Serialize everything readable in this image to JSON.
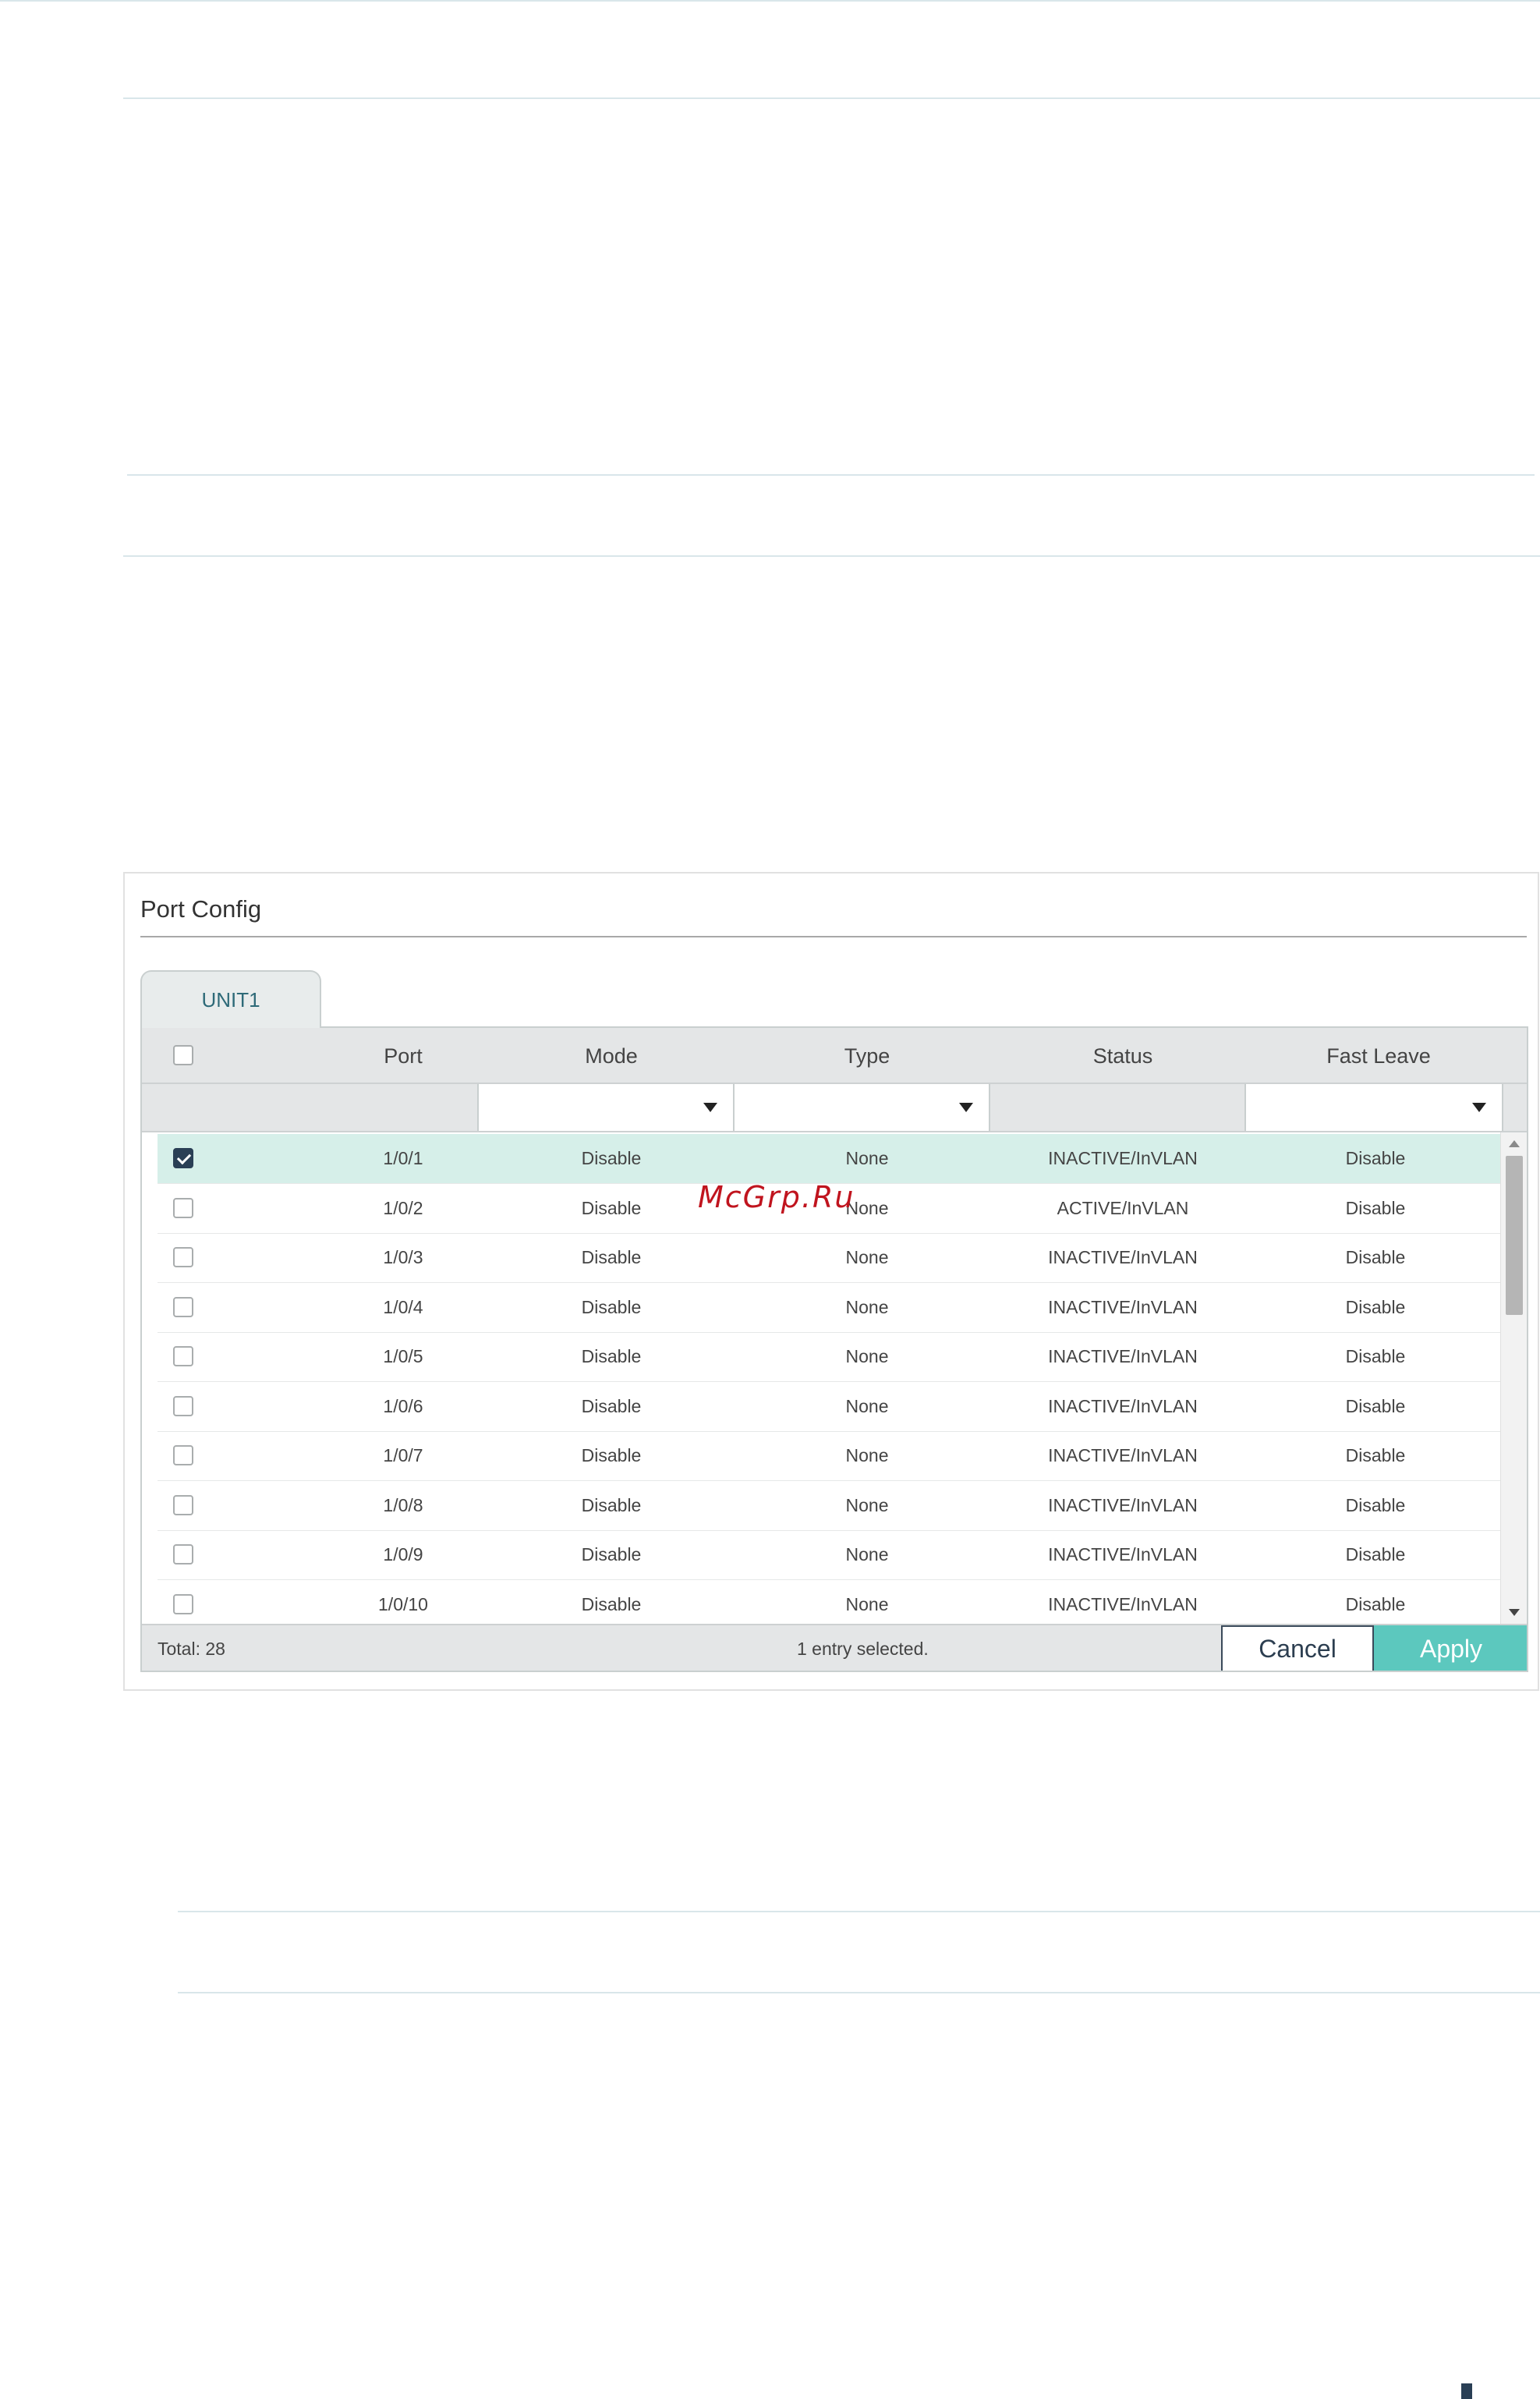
{
  "panel": {
    "title": "Port Config",
    "tab": "UNIT1"
  },
  "table": {
    "columns": [
      "Port",
      "Mode",
      "Type",
      "Status",
      "Fast Leave"
    ],
    "rows": [
      {
        "port": "1/0/1",
        "mode": "Disable",
        "type": "None",
        "status": "INACTIVE/InVLAN",
        "fast_leave": "Disable",
        "checked": true
      },
      {
        "port": "1/0/2",
        "mode": "Disable",
        "type": "None",
        "status": "ACTIVE/InVLAN",
        "fast_leave": "Disable",
        "checked": false
      },
      {
        "port": "1/0/3",
        "mode": "Disable",
        "type": "None",
        "status": "INACTIVE/InVLAN",
        "fast_leave": "Disable",
        "checked": false
      },
      {
        "port": "1/0/4",
        "mode": "Disable",
        "type": "None",
        "status": "INACTIVE/InVLAN",
        "fast_leave": "Disable",
        "checked": false
      },
      {
        "port": "1/0/5",
        "mode": "Disable",
        "type": "None",
        "status": "INACTIVE/InVLAN",
        "fast_leave": "Disable",
        "checked": false
      },
      {
        "port": "1/0/6",
        "mode": "Disable",
        "type": "None",
        "status": "INACTIVE/InVLAN",
        "fast_leave": "Disable",
        "checked": false
      },
      {
        "port": "1/0/7",
        "mode": "Disable",
        "type": "None",
        "status": "INACTIVE/InVLAN",
        "fast_leave": "Disable",
        "checked": false
      },
      {
        "port": "1/0/8",
        "mode": "Disable",
        "type": "None",
        "status": "INACTIVE/InVLAN",
        "fast_leave": "Disable",
        "checked": false
      },
      {
        "port": "1/0/9",
        "mode": "Disable",
        "type": "None",
        "status": "INACTIVE/InVLAN",
        "fast_leave": "Disable",
        "checked": false
      },
      {
        "port": "1/0/10",
        "mode": "Disable",
        "type": "None",
        "status": "INACTIVE/InVLAN",
        "fast_leave": "Disable",
        "checked": false
      }
    ]
  },
  "footer": {
    "total": "Total: 28",
    "selected_info": "1 entry selected.",
    "cancel_label": "Cancel",
    "apply_label": "Apply"
  },
  "watermark": "McGrp.Ru",
  "colors": {
    "accent": "#5cc8be",
    "selected_row": "#d6efe9",
    "checkbox_checked": "#2a3f55",
    "watermark": "#c0141e"
  }
}
